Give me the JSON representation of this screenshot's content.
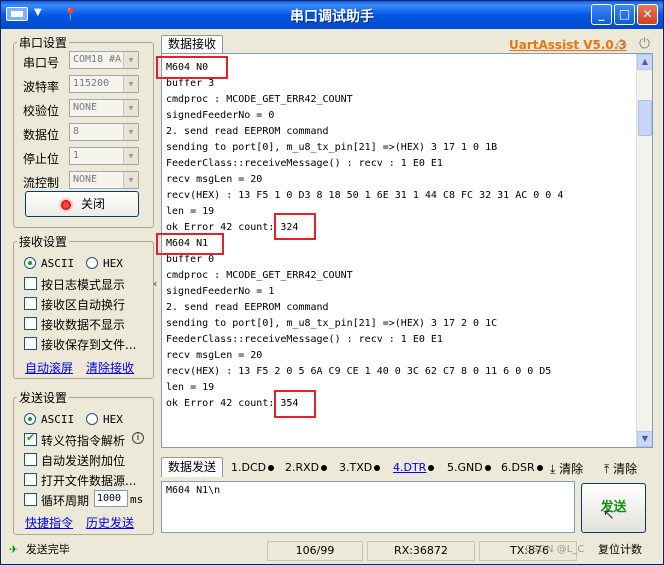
{
  "window": {
    "title": "串口调试助手"
  },
  "brand": {
    "name": "UartAssist V5.0.3",
    "color": "#e87511"
  },
  "serial_settings": {
    "group_title": "串口设置",
    "port_label": "串口号",
    "port_value": "COM18 #A",
    "baud_label": "波特率",
    "baud_value": "115200",
    "parity_label": "校验位",
    "parity_value": "NONE",
    "databits_label": "数据位",
    "databits_value": "8",
    "stopbits_label": "停止位",
    "stopbits_value": "1",
    "flow_label": "流控制",
    "flow_value": "NONE",
    "close_button": "关闭"
  },
  "receive_settings": {
    "group_title": "接收设置",
    "ascii_label": "ASCII",
    "hex_label": "HEX",
    "options": [
      "按日志模式显示",
      "接收区自动换行",
      "接收数据不显示",
      "接收保存到文件..."
    ],
    "auto_scroll": "自动滚屏",
    "clear_receive": "清除接收"
  },
  "send_settings": {
    "group_title": "发送设置",
    "ascii_label": "ASCII",
    "hex_label": "HEX",
    "escape_label": "转义符指令解析",
    "auto_append_label": "自动发送附加位",
    "open_file_label": "打开文件数据源...",
    "cycle_label": "循环周期",
    "cycle_value": "1000",
    "cycle_unit": "ms",
    "quick_cmd": "快捷指令",
    "history": "历史发送"
  },
  "receive_tab": {
    "label": "数据接收",
    "lines": [
      "M604 N0",
      "buffer 3",
      "cmdproc : MCODE_GET_ERR42_COUNT",
      "signedFeederNo = 0",
      "2. send read EEPROM command",
      "sending to port[0], m_u8_tx_pin[21] =>(HEX) 3 17 1 0 1B",
      "FeederClass::receiveMessage() : recv : 1 E0 E1",
      "recv msgLen = 20",
      "recv(HEX) : 13 F5 1 0 D3 8 18 50 1 6E 31 1 44 C8 FC 32 31 AC 0 0 4",
      "len = 19",
      "ok Error 42 count: 324",
      "M604 N1",
      "buffer 0",
      "cmdproc : MCODE_GET_ERR42_COUNT",
      "signedFeederNo = 1",
      "2. send read EEPROM command",
      "sending to port[0], m_u8_tx_pin[21] =>(HEX) 3 17 2 0 1C",
      "FeederClass::receiveMessage() : recv : 1 E0 E1",
      "recv msgLen = 20",
      "recv(HEX) : 13 F5 2 0 5 6A C9 CE 1 40 0 3C 62 C7 8 0 11 6 0 0 D5",
      "len = 19",
      "ok Error 42 count: 354"
    ]
  },
  "send_bar": {
    "tab_label": "数据发送",
    "dcd": "1.DCD",
    "rxd": "2.RXD",
    "txd": "3.TXD",
    "dtr": "4.DTR",
    "gnd": "5.GND",
    "dsr": "6.DSR",
    "clear1": "清除",
    "clear2": "清除",
    "send_text": "M604 N1\\n",
    "send_button": "发送"
  },
  "status_bar": {
    "message": "发送完毕",
    "counter": "106/99",
    "rx": "RX:36872",
    "tx": "TX:876",
    "reset": "复位计数"
  },
  "watermark": "CSDN @L_C"
}
